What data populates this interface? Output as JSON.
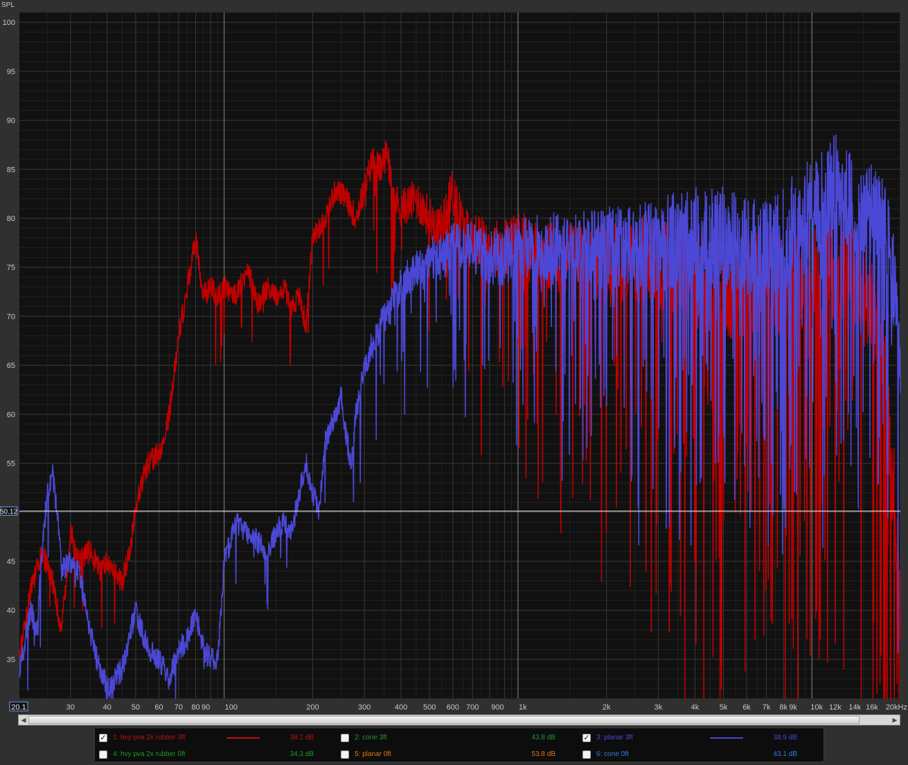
{
  "chart_data": {
    "type": "line",
    "ylabel": "SPL",
    "x_unit": "Hz",
    "xscale": "log",
    "xlim": [
      20.1,
      20000
    ],
    "ylim": [
      31,
      101
    ],
    "grid": true,
    "y_ticks": [
      "100",
      "95",
      "90",
      "85",
      "80",
      "75",
      "70",
      "65",
      "60",
      "55",
      "50",
      "45",
      "40",
      "35"
    ],
    "x_ticks": [
      {
        "v": 20.1,
        "label": "20.1"
      },
      {
        "v": 30,
        "label": "30"
      },
      {
        "v": 40,
        "label": "40"
      },
      {
        "v": 50,
        "label": "50"
      },
      {
        "v": 60,
        "label": "60"
      },
      {
        "v": 70,
        "label": "70"
      },
      {
        "v": 80,
        "label": "80"
      },
      {
        "v": 90,
        "label": "90"
      },
      {
        "v": 100,
        "label": "100"
      },
      {
        "v": 200,
        "label": "200"
      },
      {
        "v": 300,
        "label": "300"
      },
      {
        "v": 400,
        "label": "400"
      },
      {
        "v": 500,
        "label": "500"
      },
      {
        "v": 600,
        "label": "600"
      },
      {
        "v": 700,
        "label": "700"
      },
      {
        "v": 900,
        "label": "900"
      },
      {
        "v": 1000,
        "label": "1k"
      },
      {
        "v": 2000,
        "label": "2k"
      },
      {
        "v": 3000,
        "label": "3k"
      },
      {
        "v": 4000,
        "label": "4k"
      },
      {
        "v": 5000,
        "label": "5k"
      },
      {
        "v": 6000,
        "label": "6k"
      },
      {
        "v": 7000,
        "label": "7k"
      },
      {
        "v": 8000,
        "label": "8k"
      },
      {
        "v": 9000,
        "label": "9k"
      },
      {
        "v": 10000,
        "label": "10k"
      },
      {
        "v": 12000,
        "label": "12k"
      },
      {
        "v": 14000,
        "label": "14k"
      },
      {
        "v": 16000,
        "label": "16k"
      },
      {
        "v": 20000,
        "label": "20kHz"
      }
    ],
    "cursor": {
      "y": 50.12,
      "label": "50.12"
    },
    "series": [
      {
        "name": "1: hvy pva 2x rubber 3ft",
        "color": "#c00000",
        "spread": 0.62,
        "x": [
          20.1,
          22,
          24,
          26,
          28,
          30,
          32,
          35,
          38,
          40,
          42,
          45,
          48,
          50,
          55,
          60,
          65,
          70,
          75,
          80,
          85,
          90,
          95,
          100,
          110,
          120,
          130,
          140,
          150,
          160,
          170,
          180,
          190,
          200,
          210,
          220,
          240,
          260,
          280,
          300,
          320,
          340,
          360,
          380,
          400,
          450,
          500,
          550,
          600,
          650,
          700,
          800,
          900,
          1000,
          1200,
          1500,
          1800,
          2000,
          2500,
          3000,
          3500,
          4000,
          5000,
          6000,
          7000,
          8000,
          9000,
          10000,
          11000,
          12000,
          13000,
          14000,
          15000,
          16000,
          17000,
          18000,
          19000,
          20000
        ],
        "y": [
          35,
          42,
          46,
          43,
          38,
          48,
          45,
          46,
          44,
          45,
          44,
          43,
          46,
          51,
          55,
          56,
          60,
          68,
          73,
          78,
          72,
          73,
          72,
          73,
          72,
          75,
          71,
          73,
          72,
          73,
          71,
          72,
          69,
          78,
          79,
          80,
          83,
          82,
          80,
          83,
          86,
          85,
          87,
          82,
          81,
          82,
          80,
          79,
          83,
          79,
          78,
          77,
          77,
          78,
          76,
          76,
          75,
          75,
          76,
          75,
          75,
          74,
          73,
          73,
          74,
          73,
          73,
          74,
          74,
          75,
          74,
          74,
          72,
          71,
          69,
          62,
          52,
          40
        ]
      },
      {
        "name": "3: planar 3ft",
        "color": "#4b48d6",
        "spread": 0.42,
        "x": [
          20.1,
          22,
          23,
          24,
          25,
          26,
          27,
          28,
          30,
          32,
          34,
          36,
          38,
          40,
          45,
          50,
          55,
          60,
          65,
          70,
          75,
          80,
          85,
          90,
          95,
          100,
          110,
          120,
          130,
          140,
          150,
          160,
          170,
          180,
          190,
          200,
          210,
          220,
          240,
          250,
          260,
          270,
          280,
          300,
          320,
          340,
          360,
          380,
          400,
          450,
          500,
          550,
          600,
          700,
          800,
          900,
          1000,
          1200,
          1500,
          1800,
          2000,
          2500,
          3000,
          3500,
          4000,
          5000,
          6000,
          7000,
          8000,
          9000,
          10000,
          11000,
          12000,
          13000,
          14000,
          15000,
          16000,
          17000,
          18000,
          19000,
          20000
        ],
        "y": [
          34,
          40,
          38,
          46,
          52,
          54,
          50,
          44,
          45,
          44,
          40,
          36,
          34,
          32,
          34,
          40,
          36,
          35,
          33,
          36,
          37,
          40,
          36,
          35,
          35,
          45,
          49,
          48,
          47,
          46,
          48,
          49,
          48,
          52,
          55,
          52,
          50,
          57,
          60,
          62,
          58,
          55,
          60,
          65,
          67,
          69,
          70,
          72,
          73,
          75,
          76,
          76,
          77,
          77,
          76,
          76,
          77,
          77,
          77,
          77,
          77,
          77,
          77,
          78,
          78,
          78,
          77,
          77,
          78,
          80,
          81,
          82,
          84,
          82,
          81,
          80,
          81,
          80,
          78,
          73,
          62
        ]
      }
    ]
  },
  "axis_title": "SPL",
  "legend": [
    {
      "label": "1: hvy pva 2x rubber 3ft",
      "value": "38.1 dB",
      "checked": true,
      "color": "#c01010",
      "value_color": "#c01010",
      "swatch": true
    },
    {
      "label": "2: cone 3ft",
      "value": "43.8 dB",
      "checked": false,
      "color": "#1e9a2a",
      "value_color": "#1e9a2a",
      "swatch": false
    },
    {
      "label": "3: planar 3ft",
      "value": "38.9 dB",
      "checked": true,
      "color": "#4b48d6",
      "value_color": "#4b48d6",
      "swatch": true
    },
    {
      "label": "4: hvy pva 2x rubber 0ft",
      "value": "34.3 dB",
      "checked": false,
      "color": "#1e9a2a",
      "value_color": "#1e9a2a",
      "swatch": false
    },
    {
      "label": "5: planar 0ft",
      "value": "53.8 dB",
      "checked": false,
      "color": "#e07810",
      "value_color": "#e07810",
      "swatch": false
    },
    {
      "label": "6: cone 0ft",
      "value": "43.1 dB",
      "checked": false,
      "color": "#2f7fe0",
      "value_color": "#2f7fe0",
      "swatch": false
    }
  ],
  "scroll": {
    "left_arrow": "◀",
    "right_arrow": "▶"
  }
}
